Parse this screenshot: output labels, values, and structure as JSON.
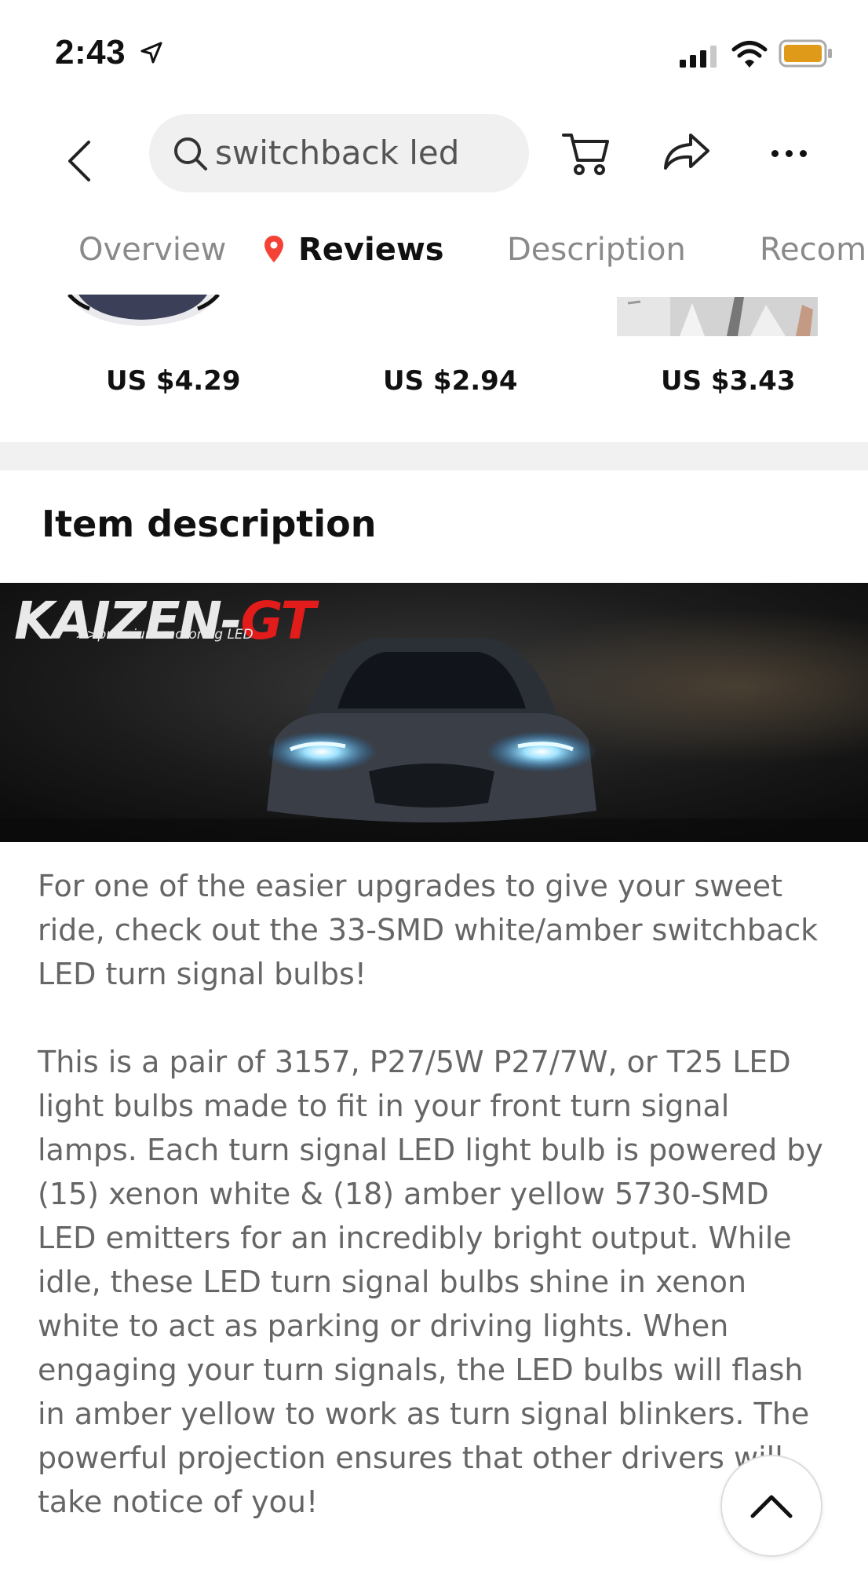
{
  "status_bar": {
    "time": "2:43"
  },
  "search": {
    "query": "switchback led"
  },
  "tabs": [
    {
      "label": "Overview"
    },
    {
      "label": "Reviews"
    },
    {
      "label": "Description"
    },
    {
      "label": "Recomm"
    }
  ],
  "products": [
    {
      "price": "US $4.29"
    },
    {
      "price": "US $2.94"
    },
    {
      "price": "US $3.43"
    }
  ],
  "section": {
    "title": "Item description"
  },
  "banner": {
    "brand": "KAIZEN-",
    "brand_accent": "GT",
    "tagline": ">>premium motoring LED"
  },
  "description": {
    "paragraphs": [
      "For one of the easier upgrades to give your sweet ride, check out the 33-SMD white/amber switchback LED turn signal bulbs!",
      "This is a pair of 3157, P27/5W P27/7W, or T25 LED light bulbs made to fit in your front turn signal lamps. Each turn signal LED light bulb is powered by (15) xenon white & (18) amber yellow 5730-SMD LED emitters for an incredibly bright output. While idle, these LED turn signal bulbs shine in xenon white to act as parking or driving lights. When engaging your turn signals, the LED bulbs will flash in amber yellow to work as turn signal blinkers. The powerful projection ensures that other drivers will take notice of you!"
    ]
  },
  "colors": {
    "active_tab_pin": "#f44336",
    "brand_accent": "#e21b1b",
    "battery": "#e09a1a"
  }
}
